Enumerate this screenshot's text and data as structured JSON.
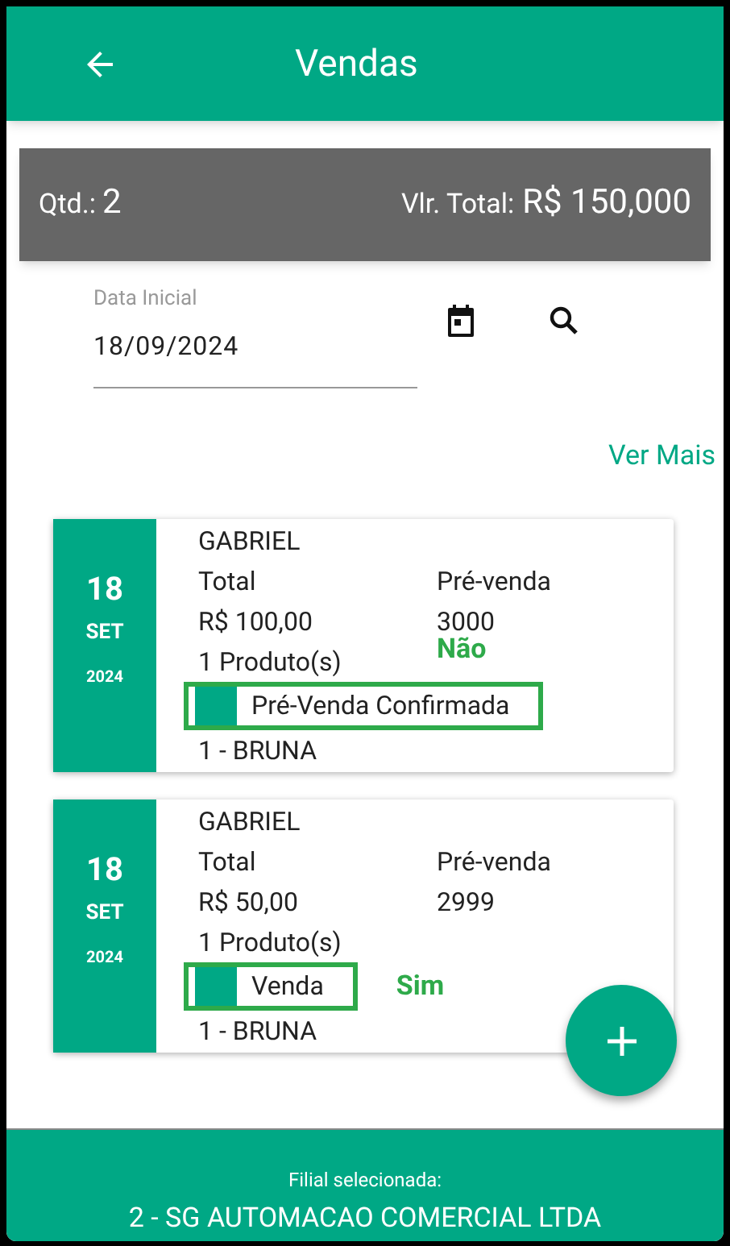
{
  "header": {
    "title": "Vendas"
  },
  "summary": {
    "qty_label": "Qtd.:",
    "qty": "2",
    "total_label": "Vlr. Total:",
    "total": "R$ 150,000"
  },
  "date_field": {
    "label": "Data Inicial",
    "value": "18/09/2024"
  },
  "see_more": "Ver Mais",
  "sales": [
    {
      "day": "18",
      "month": "SET",
      "year": "2024",
      "customer": "GABRIEL",
      "total_label": "Total",
      "total": "R$ 100,00",
      "order_label": "Pré-venda",
      "order": "3000",
      "products": "1 Produto(s)",
      "status": "Pré-Venda Confirmada",
      "seller": "1 - BRUNA",
      "annotation": "Não",
      "annotation_beside_status": false
    },
    {
      "day": "18",
      "month": "SET",
      "year": "2024",
      "customer": "GABRIEL",
      "total_label": "Total",
      "total": "R$ 50,00",
      "order_label": "Pré-venda",
      "order": "2999",
      "products": "1 Produto(s)",
      "status": "Venda",
      "seller": "1 - BRUNA",
      "annotation": "Sim",
      "annotation_beside_status": true
    }
  ],
  "footer": {
    "label": "Filial selecionada:",
    "branch": "2 - SG AUTOMACAO COMERCIAL LTDA"
  }
}
